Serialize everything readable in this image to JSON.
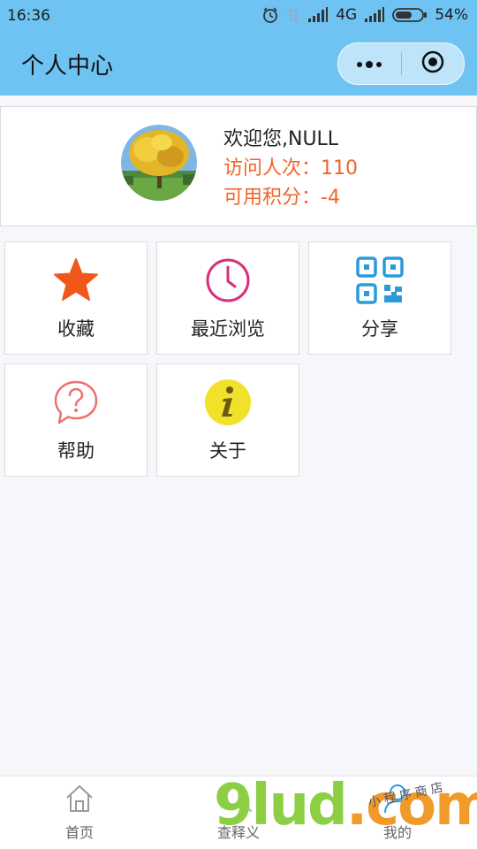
{
  "status_bar": {
    "time": "16:36",
    "network": "4G",
    "battery": "54%"
  },
  "nav": {
    "title": "个人中心",
    "more_icon": "more-dots-icon",
    "close_icon": "target-close-icon"
  },
  "profile": {
    "welcome": "欢迎您,NULL",
    "visits": "访问人次：110",
    "points": "可用积分：-4",
    "avatar_icon": "tree-photo"
  },
  "grid": {
    "items": [
      {
        "label": "收藏",
        "icon": "star-icon",
        "color": "#f0581b"
      },
      {
        "label": "最近浏览",
        "icon": "clock-icon",
        "color": "#d8307a"
      },
      {
        "label": "分享",
        "icon": "qrcode-icon",
        "color": "#2a9bd8"
      },
      {
        "label": "帮助",
        "icon": "help-bubble-icon",
        "color": "#f07070"
      },
      {
        "label": "关于",
        "icon": "info-icon",
        "color": "#f2e12a"
      }
    ]
  },
  "tabbar": {
    "items": [
      {
        "label": "首页",
        "icon": "home-icon"
      },
      {
        "label": "查释义",
        "icon": "search-icon"
      },
      {
        "label": "我的",
        "icon": "user-icon"
      }
    ]
  },
  "watermark": {
    "brand_a": "9lud",
    "brand_b": ".com",
    "tagline": "小程序商店"
  },
  "colors": {
    "header": "#6ec3f2",
    "accent_orange": "#f0652a",
    "background": "#f6f7fb"
  }
}
